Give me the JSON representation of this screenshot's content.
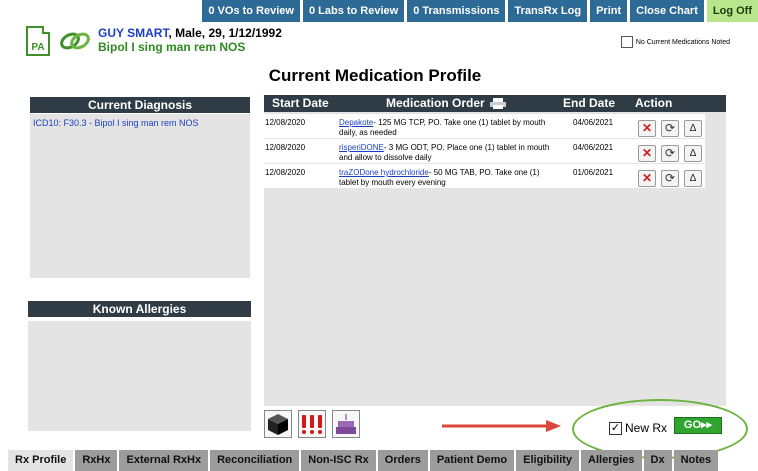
{
  "toolbar": {
    "vos_label": "0 VOs to Review",
    "labs_label": "0 Labs to Review",
    "transmissions_label": "0 Transmissions",
    "transrx_log_label": "TransRx Log",
    "print_label": "Print",
    "close_chart_label": "Close Chart",
    "log_off_label": "Log Off"
  },
  "patient": {
    "pa_badge": "PA",
    "name": "GUY SMART",
    "demographics": ", Male, 29, 1/12/1992",
    "diagnosis_line": "Bipol I sing man rem NOS"
  },
  "no_current_meds_label": "No Current Medications Noted",
  "page_title": "Current Medication Profile",
  "current_diagnosis": {
    "title": "Current Diagnosis",
    "entry": "ICD10: F30.3 - Bipol I sing man rem NOS"
  },
  "known_allergies": {
    "title": "Known Allergies"
  },
  "med_table": {
    "headers": {
      "start_date": "Start Date",
      "medication_order": "Medication Order",
      "end_date": "End Date",
      "action": "Action"
    },
    "rows": [
      {
        "start": "12/08/2020",
        "drug": "Depakote",
        "details": "- 125 MG TCP, PO. Take one (1) tablet by mouth daily, as needed",
        "end": "04/06/2021"
      },
      {
        "start": "12/08/2020",
        "drug": "risperiDONE",
        "details": "- 3 MG ODT, PO. Place one (1) tablet in mouth and allow to dissolve daily",
        "end": "04/06/2021"
      },
      {
        "start": "12/08/2020",
        "drug": "traZODone hydrochloride",
        "details": "- 50 MG TAB, PO. Take one (1) tablet by mouth every evening",
        "end": "01/06/2021"
      }
    ],
    "action_glyphs": {
      "discontinue": "✕",
      "renew": "⟳",
      "change": "Δ"
    }
  },
  "new_rx": {
    "label": "New Rx",
    "checked": true,
    "go_label": "GO▸▸"
  },
  "tabs": [
    "Rx Profile",
    "RxHx",
    "External RxHx",
    "Reconciliation",
    "Non-ISC Rx",
    "Orders",
    "Patient Demo",
    "Eligibility",
    "Allergies",
    "Dx",
    "Notes"
  ],
  "colors": {
    "toolbar_blue": "#2e6a96",
    "log_off_green": "#b9e58c",
    "header_dark": "#2f3b45",
    "highlight_green": "#6db33f",
    "arrow_red": "#d9473a"
  }
}
